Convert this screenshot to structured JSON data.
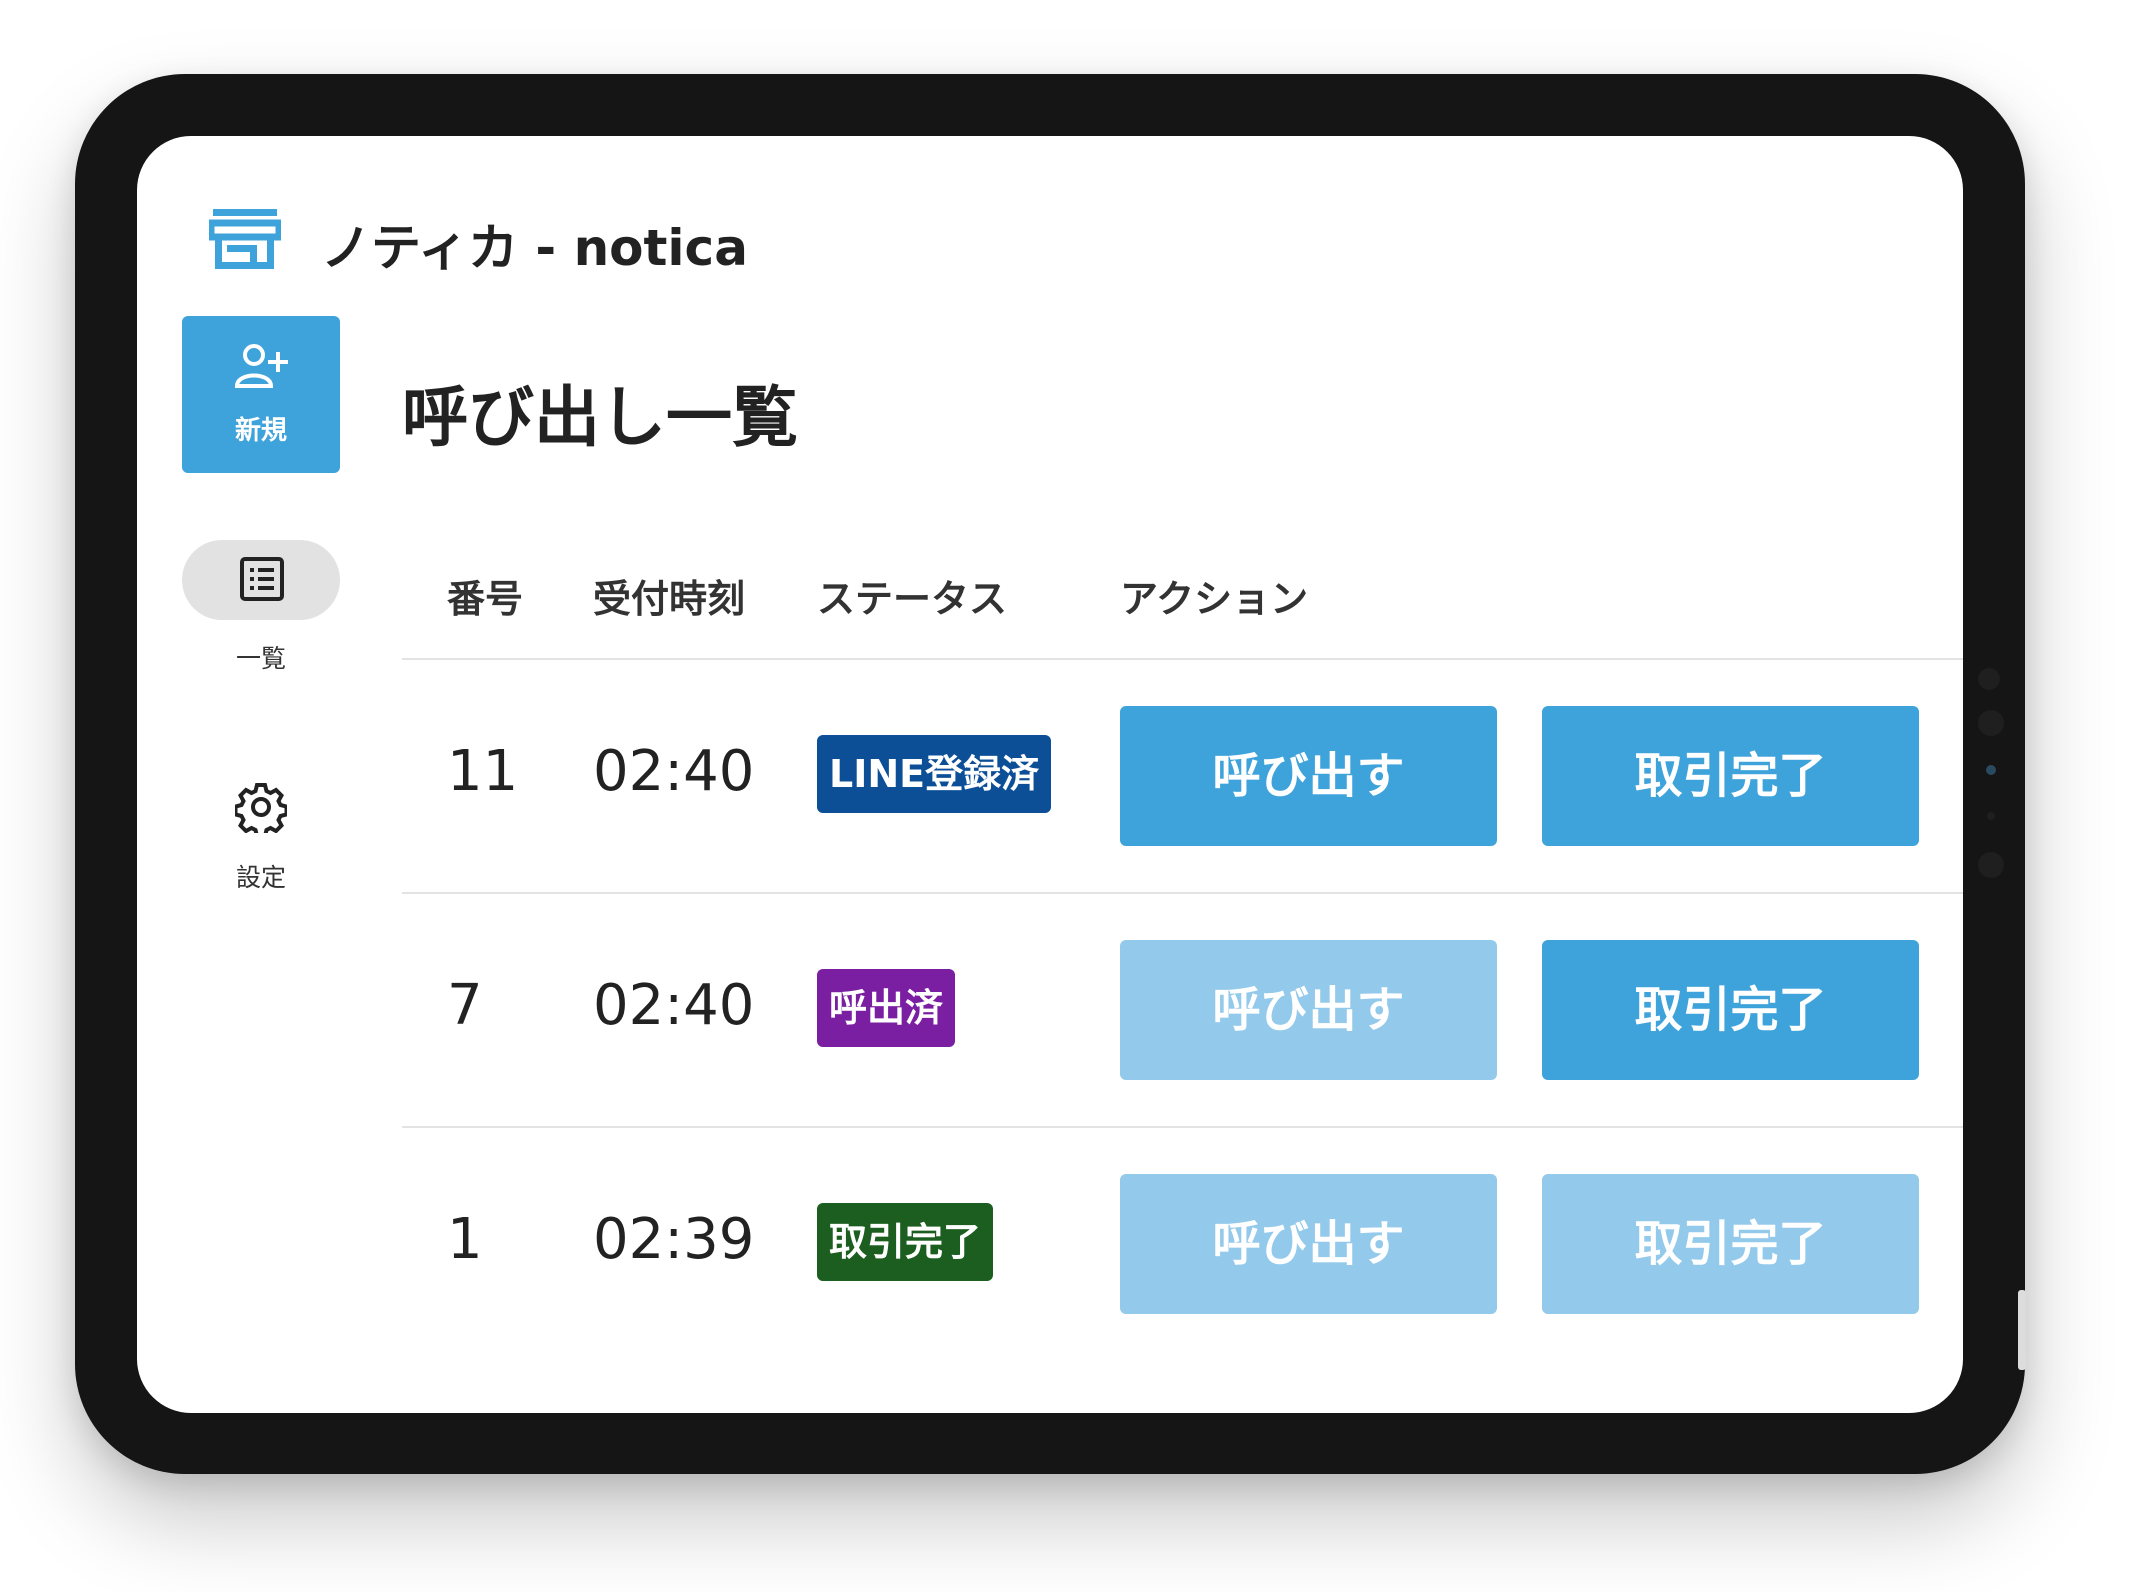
{
  "app": {
    "title": "ノティカ - notica"
  },
  "sidebar": {
    "new_label": "新規",
    "list_label": "一覧",
    "settings_label": "設定"
  },
  "main": {
    "title": "呼び出し一覧",
    "columns": [
      "番号",
      "受付時刻",
      "ステータス",
      "アクション"
    ],
    "rows": [
      {
        "number": "11",
        "time": "02:40",
        "status": "LINE登録済",
        "status_color": "#0d4f97",
        "call_label": "呼び出す",
        "call_enabled": true,
        "complete_label": "取引完了",
        "complete_enabled": true
      },
      {
        "number": "7",
        "time": "02:40",
        "status": "呼出済",
        "status_color": "#7a1fa2",
        "call_label": "呼び出す",
        "call_enabled": false,
        "complete_label": "取引完了",
        "complete_enabled": true
      },
      {
        "number": "1",
        "time": "02:39",
        "status": "取引完了",
        "status_color": "#1b5e20",
        "call_label": "呼び出す",
        "call_enabled": false,
        "complete_label": "取引完了",
        "complete_enabled": false
      }
    ]
  },
  "colors": {
    "accent": "#3fa3db",
    "accent_disabled": "#93c9eb"
  }
}
